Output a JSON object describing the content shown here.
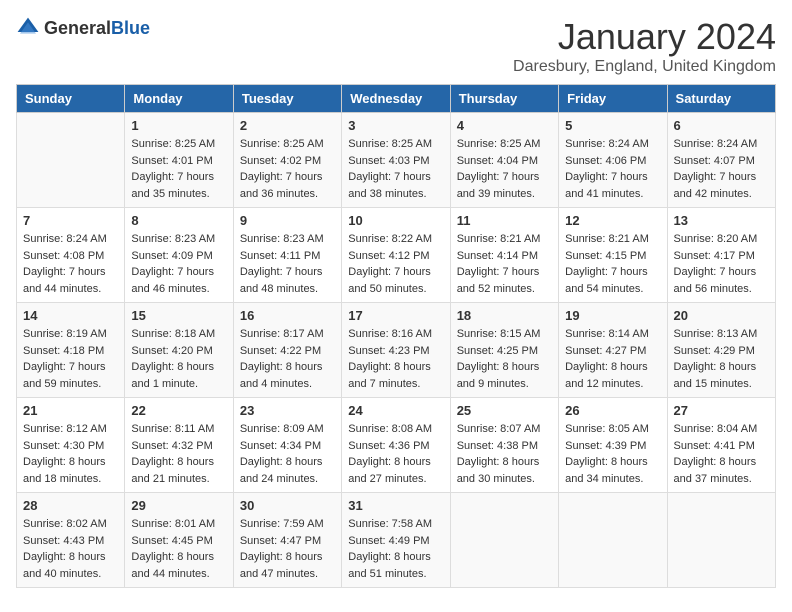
{
  "header": {
    "logo_general": "General",
    "logo_blue": "Blue",
    "title": "January 2024",
    "location": "Daresbury, England, United Kingdom"
  },
  "weekdays": [
    "Sunday",
    "Monday",
    "Tuesday",
    "Wednesday",
    "Thursday",
    "Friday",
    "Saturday"
  ],
  "weeks": [
    [
      {
        "day": "",
        "sunrise": "",
        "sunset": "",
        "daylight": ""
      },
      {
        "day": "1",
        "sunrise": "Sunrise: 8:25 AM",
        "sunset": "Sunset: 4:01 PM",
        "daylight": "Daylight: 7 hours and 35 minutes."
      },
      {
        "day": "2",
        "sunrise": "Sunrise: 8:25 AM",
        "sunset": "Sunset: 4:02 PM",
        "daylight": "Daylight: 7 hours and 36 minutes."
      },
      {
        "day": "3",
        "sunrise": "Sunrise: 8:25 AM",
        "sunset": "Sunset: 4:03 PM",
        "daylight": "Daylight: 7 hours and 38 minutes."
      },
      {
        "day": "4",
        "sunrise": "Sunrise: 8:25 AM",
        "sunset": "Sunset: 4:04 PM",
        "daylight": "Daylight: 7 hours and 39 minutes."
      },
      {
        "day": "5",
        "sunrise": "Sunrise: 8:24 AM",
        "sunset": "Sunset: 4:06 PM",
        "daylight": "Daylight: 7 hours and 41 minutes."
      },
      {
        "day": "6",
        "sunrise": "Sunrise: 8:24 AM",
        "sunset": "Sunset: 4:07 PM",
        "daylight": "Daylight: 7 hours and 42 minutes."
      }
    ],
    [
      {
        "day": "7",
        "sunrise": "Sunrise: 8:24 AM",
        "sunset": "Sunset: 4:08 PM",
        "daylight": "Daylight: 7 hours and 44 minutes."
      },
      {
        "day": "8",
        "sunrise": "Sunrise: 8:23 AM",
        "sunset": "Sunset: 4:09 PM",
        "daylight": "Daylight: 7 hours and 46 minutes."
      },
      {
        "day": "9",
        "sunrise": "Sunrise: 8:23 AM",
        "sunset": "Sunset: 4:11 PM",
        "daylight": "Daylight: 7 hours and 48 minutes."
      },
      {
        "day": "10",
        "sunrise": "Sunrise: 8:22 AM",
        "sunset": "Sunset: 4:12 PM",
        "daylight": "Daylight: 7 hours and 50 minutes."
      },
      {
        "day": "11",
        "sunrise": "Sunrise: 8:21 AM",
        "sunset": "Sunset: 4:14 PM",
        "daylight": "Daylight: 7 hours and 52 minutes."
      },
      {
        "day": "12",
        "sunrise": "Sunrise: 8:21 AM",
        "sunset": "Sunset: 4:15 PM",
        "daylight": "Daylight: 7 hours and 54 minutes."
      },
      {
        "day": "13",
        "sunrise": "Sunrise: 8:20 AM",
        "sunset": "Sunset: 4:17 PM",
        "daylight": "Daylight: 7 hours and 56 minutes."
      }
    ],
    [
      {
        "day": "14",
        "sunrise": "Sunrise: 8:19 AM",
        "sunset": "Sunset: 4:18 PM",
        "daylight": "Daylight: 7 hours and 59 minutes."
      },
      {
        "day": "15",
        "sunrise": "Sunrise: 8:18 AM",
        "sunset": "Sunset: 4:20 PM",
        "daylight": "Daylight: 8 hours and 1 minute."
      },
      {
        "day": "16",
        "sunrise": "Sunrise: 8:17 AM",
        "sunset": "Sunset: 4:22 PM",
        "daylight": "Daylight: 8 hours and 4 minutes."
      },
      {
        "day": "17",
        "sunrise": "Sunrise: 8:16 AM",
        "sunset": "Sunset: 4:23 PM",
        "daylight": "Daylight: 8 hours and 7 minutes."
      },
      {
        "day": "18",
        "sunrise": "Sunrise: 8:15 AM",
        "sunset": "Sunset: 4:25 PM",
        "daylight": "Daylight: 8 hours and 9 minutes."
      },
      {
        "day": "19",
        "sunrise": "Sunrise: 8:14 AM",
        "sunset": "Sunset: 4:27 PM",
        "daylight": "Daylight: 8 hours and 12 minutes."
      },
      {
        "day": "20",
        "sunrise": "Sunrise: 8:13 AM",
        "sunset": "Sunset: 4:29 PM",
        "daylight": "Daylight: 8 hours and 15 minutes."
      }
    ],
    [
      {
        "day": "21",
        "sunrise": "Sunrise: 8:12 AM",
        "sunset": "Sunset: 4:30 PM",
        "daylight": "Daylight: 8 hours and 18 minutes."
      },
      {
        "day": "22",
        "sunrise": "Sunrise: 8:11 AM",
        "sunset": "Sunset: 4:32 PM",
        "daylight": "Daylight: 8 hours and 21 minutes."
      },
      {
        "day": "23",
        "sunrise": "Sunrise: 8:09 AM",
        "sunset": "Sunset: 4:34 PM",
        "daylight": "Daylight: 8 hours and 24 minutes."
      },
      {
        "day": "24",
        "sunrise": "Sunrise: 8:08 AM",
        "sunset": "Sunset: 4:36 PM",
        "daylight": "Daylight: 8 hours and 27 minutes."
      },
      {
        "day": "25",
        "sunrise": "Sunrise: 8:07 AM",
        "sunset": "Sunset: 4:38 PM",
        "daylight": "Daylight: 8 hours and 30 minutes."
      },
      {
        "day": "26",
        "sunrise": "Sunrise: 8:05 AM",
        "sunset": "Sunset: 4:39 PM",
        "daylight": "Daylight: 8 hours and 34 minutes."
      },
      {
        "day": "27",
        "sunrise": "Sunrise: 8:04 AM",
        "sunset": "Sunset: 4:41 PM",
        "daylight": "Daylight: 8 hours and 37 minutes."
      }
    ],
    [
      {
        "day": "28",
        "sunrise": "Sunrise: 8:02 AM",
        "sunset": "Sunset: 4:43 PM",
        "daylight": "Daylight: 8 hours and 40 minutes."
      },
      {
        "day": "29",
        "sunrise": "Sunrise: 8:01 AM",
        "sunset": "Sunset: 4:45 PM",
        "daylight": "Daylight: 8 hours and 44 minutes."
      },
      {
        "day": "30",
        "sunrise": "Sunrise: 7:59 AM",
        "sunset": "Sunset: 4:47 PM",
        "daylight": "Daylight: 8 hours and 47 minutes."
      },
      {
        "day": "31",
        "sunrise": "Sunrise: 7:58 AM",
        "sunset": "Sunset: 4:49 PM",
        "daylight": "Daylight: 8 hours and 51 minutes."
      },
      {
        "day": "",
        "sunrise": "",
        "sunset": "",
        "daylight": ""
      },
      {
        "day": "",
        "sunrise": "",
        "sunset": "",
        "daylight": ""
      },
      {
        "day": "",
        "sunrise": "",
        "sunset": "",
        "daylight": ""
      }
    ]
  ]
}
